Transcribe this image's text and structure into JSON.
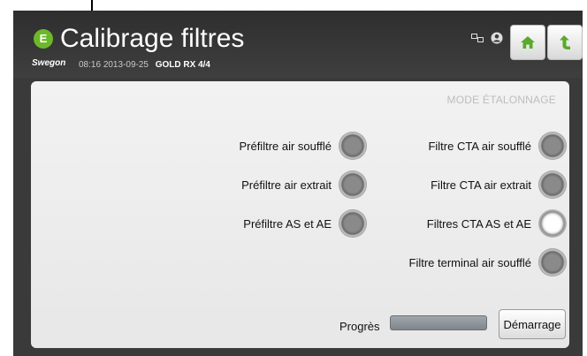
{
  "header": {
    "logo_letter": "E",
    "title": "Calibrage filtres",
    "brand": "Swegon",
    "time": "08:16",
    "date": "2013-09-25",
    "model": "GOLD RX",
    "unit": "4/4",
    "icons": [
      "network-icon",
      "user-icon",
      "home-icon",
      "back-arrow-icon"
    ]
  },
  "panel": {
    "mode_label": "MODE ÉTALONNAGE",
    "left_filters": [
      {
        "label": "Préfiltre air soufflé",
        "active": false
      },
      {
        "label": "Préfiltre air extrait",
        "active": false
      },
      {
        "label": "Préfiltre AS et AE",
        "active": false
      }
    ],
    "right_filters": [
      {
        "label": "Filtre CTA air soufflé",
        "active": false
      },
      {
        "label": "Filtre CTA air extrait",
        "active": false
      },
      {
        "label": "Filtres CTA AS et AE",
        "active": true
      },
      {
        "label": "Filtre terminal air soufflé",
        "active": false
      }
    ],
    "progress_label": "Progrès",
    "progress_fraction": 0,
    "start_label": "Démarrage"
  },
  "colors": {
    "accent_green": "#6cb82a",
    "header_bg": "#3a3a3a",
    "panel_bg": "#efefef"
  }
}
